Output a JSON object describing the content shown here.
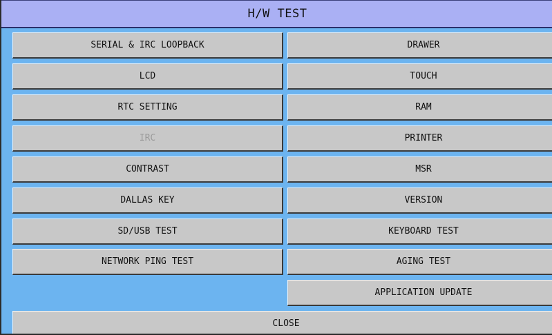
{
  "title": "H/W TEST",
  "left_buttons": [
    {
      "label": "SERIAL & IRC LOOPBACK",
      "enabled": true
    },
    {
      "label": "LCD",
      "enabled": true
    },
    {
      "label": "RTC SETTING",
      "enabled": true
    },
    {
      "label": "IRC",
      "enabled": false
    },
    {
      "label": "CONTRAST",
      "enabled": true
    },
    {
      "label": "DALLAS KEY",
      "enabled": true
    },
    {
      "label": "SD/USB TEST",
      "enabled": true
    },
    {
      "label": "NETWORK PING TEST",
      "enabled": true
    }
  ],
  "right_buttons": [
    {
      "label": "DRAWER",
      "enabled": true
    },
    {
      "label": "TOUCH",
      "enabled": true
    },
    {
      "label": "RAM",
      "enabled": true
    },
    {
      "label": "PRINTER",
      "enabled": true
    },
    {
      "label": "MSR",
      "enabled": true
    },
    {
      "label": "VERSION",
      "enabled": true
    },
    {
      "label": "KEYBOARD TEST",
      "enabled": true
    },
    {
      "label": "AGING TEST",
      "enabled": true
    },
    {
      "label": "APPLICATION UPDATE",
      "enabled": true
    }
  ],
  "close_label": "CLOSE",
  "colors": {
    "background": "#6cb4f0",
    "title_bar": "#aab0f4",
    "button": "#c8c8c8",
    "disabled_text": "#9a9a9a"
  }
}
